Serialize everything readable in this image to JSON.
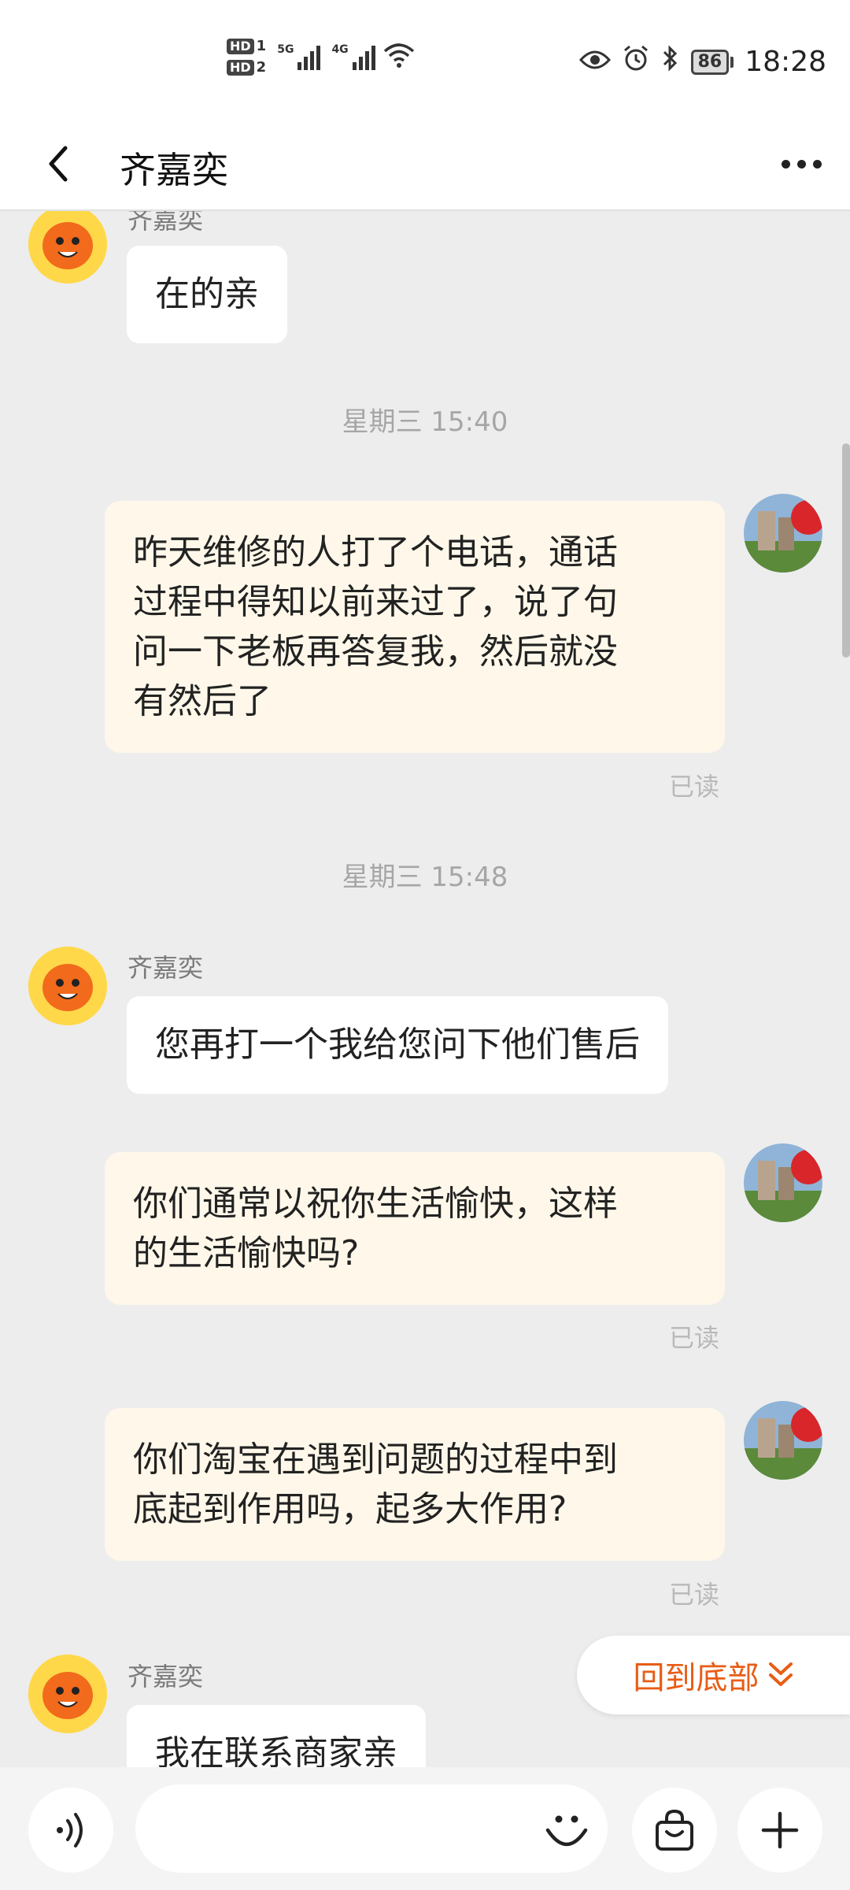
{
  "status_bar": {
    "hd1": "HD",
    "hd1_num": "1",
    "hd2": "HD",
    "hd2_num": "2",
    "net1": "5G",
    "net2": "4G",
    "battery": "86",
    "time": "18:28",
    "icons": [
      "eye-icon",
      "alarm-icon",
      "bluetooth-icon",
      "wifi-icon"
    ]
  },
  "nav": {
    "title": "齐嘉奕"
  },
  "messages": {
    "m1_sender": "齐嘉奕",
    "m1_text": "在的亲",
    "t1": "星期三 15:40",
    "m2_text": [
      "昨天维修的人打了个电话，通话",
      "过程中得知以前来过了，说了句",
      "问一下老板再答复我，然后就没",
      "有然后了"
    ],
    "m2_status": "已读",
    "t2": "星期三 15:48",
    "m3_sender": "齐嘉奕",
    "m3_text": "您再打一个我给您问下他们售后",
    "m4_text": [
      "你们通常以祝你生活愉快，这样",
      "的生活愉快吗?"
    ],
    "m4_status": "已读",
    "m5_text": [
      "你们淘宝在遇到问题的过程中到",
      "底起到作用吗，起多大作用?"
    ],
    "m5_status": "已读",
    "m6_sender": "齐嘉奕",
    "m6_text": "我在联系商家亲"
  },
  "back_to_bottom": {
    "label": "回到底部"
  },
  "colors": {
    "accent": "#e85d16",
    "outgoing_bubble": "#fff8ea",
    "incoming_bubble": "#ffffff",
    "chat_bg": "#ededed"
  }
}
